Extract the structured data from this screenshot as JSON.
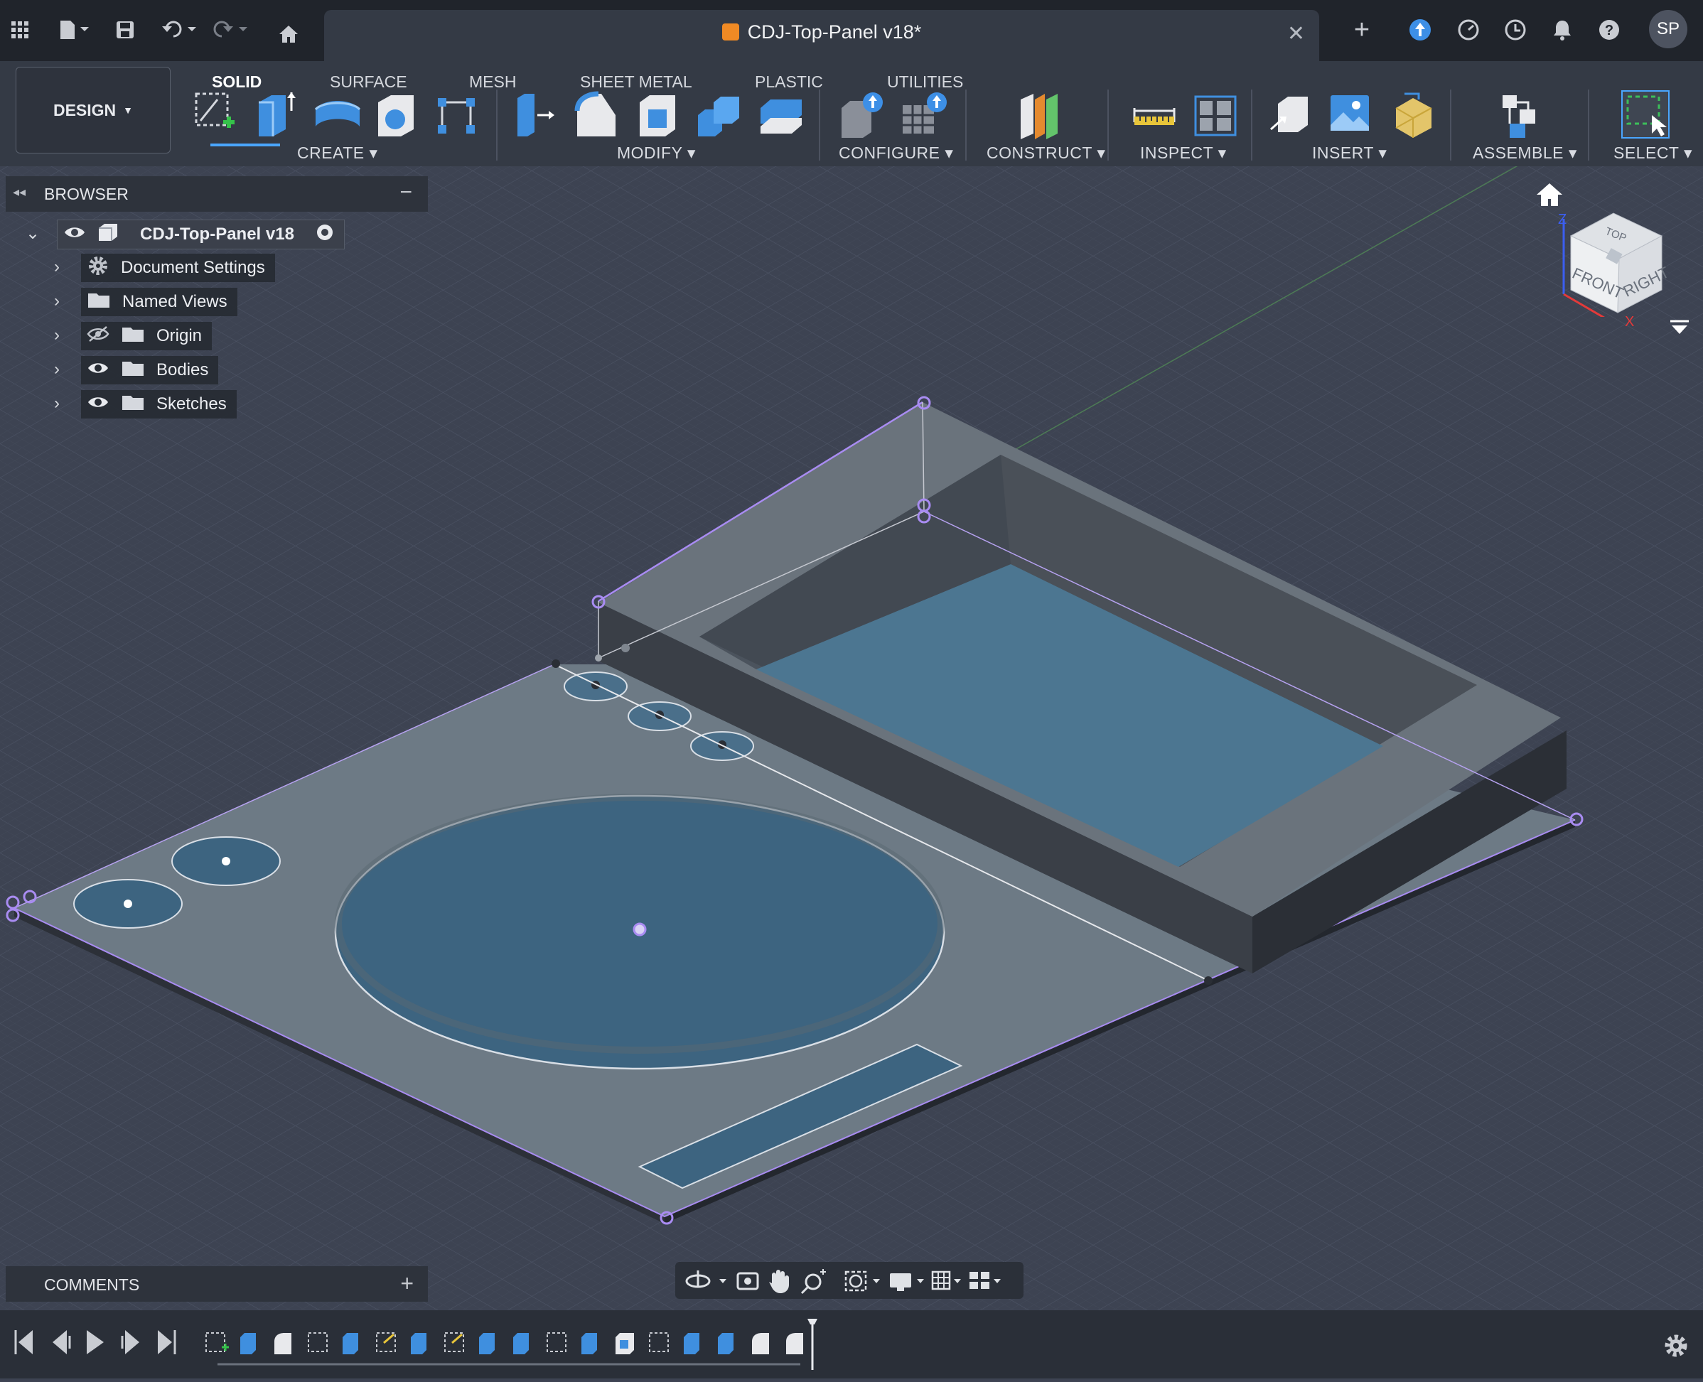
{
  "title_bar": {
    "document_title": "CDJ-Top-Panel v18*",
    "user_initials": "SP"
  },
  "workspace": {
    "mode_label": "DESIGN"
  },
  "tabs": [
    {
      "label": "SOLID"
    },
    {
      "label": "SURFACE"
    },
    {
      "label": "MESH"
    },
    {
      "label": "SHEET METAL"
    },
    {
      "label": "PLASTIC"
    },
    {
      "label": "UTILITIES"
    }
  ],
  "toolbar_groups": [
    {
      "label": "CREATE"
    },
    {
      "label": "MODIFY"
    },
    {
      "label": "CONFIGURE"
    },
    {
      "label": "CONSTRUCT"
    },
    {
      "label": "INSPECT"
    },
    {
      "label": "INSERT"
    },
    {
      "label": "ASSEMBLE"
    },
    {
      "label": "SELECT"
    }
  ],
  "browser": {
    "title": "BROWSER",
    "root": "CDJ-Top-Panel v18",
    "items": [
      {
        "label": "Document Settings",
        "icon": "gear-icon"
      },
      {
        "label": "Named Views",
        "icon": "folder-icon"
      },
      {
        "label": "Origin",
        "icon": "folder-icon",
        "visibility": "hidden"
      },
      {
        "label": "Bodies",
        "icon": "folder-icon",
        "visibility": "visible"
      },
      {
        "label": "Sketches",
        "icon": "folder-icon",
        "visibility": "visible"
      }
    ]
  },
  "viewcube": {
    "top": "TOP",
    "front": "FRONT",
    "right": "RIGHT",
    "axis_z": "Z",
    "axis_x": "X"
  },
  "comments": {
    "title": "COMMENTS"
  },
  "colors": {
    "accent": "#4aa6ff",
    "viewport_bg": "#3d4352",
    "panel_bg": "#343a45",
    "sketch_point": "#a98cf2"
  }
}
